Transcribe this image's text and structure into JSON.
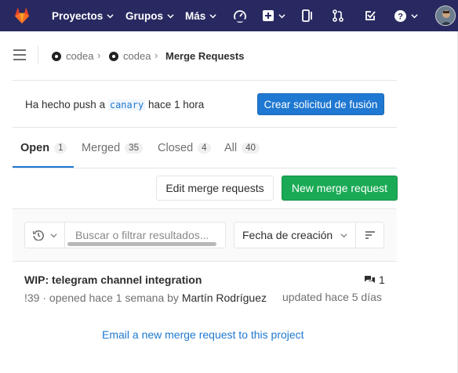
{
  "navbar": {
    "items": [
      {
        "label": "Proyectos"
      },
      {
        "label": "Grupos"
      },
      {
        "label": "Más"
      }
    ],
    "icons": [
      "gitlab-logo",
      "dashboard-gauge-icon",
      "plus-square-icon",
      "issues-icon",
      "merge-request-icon",
      "todo-check-icon",
      "help-icon",
      "user-avatar"
    ]
  },
  "breadcrumb": {
    "items": [
      {
        "label": "codea"
      },
      {
        "label": "codea"
      }
    ],
    "current": "Merge Requests"
  },
  "push_banner": {
    "prefix": "Ha hecho push a",
    "branch": "canary",
    "suffix": "hace 1 hora",
    "button_label": "Crear solicitud de fusión"
  },
  "tabs": [
    {
      "label": "Open",
      "count": "1"
    },
    {
      "label": "Merged",
      "count": "35"
    },
    {
      "label": "Closed",
      "count": "4"
    },
    {
      "label": "All",
      "count": "40"
    }
  ],
  "actions": {
    "edit_label": "Edit merge requests",
    "new_label": "New merge request"
  },
  "filter": {
    "search_placeholder": "Buscar o filtrar resultados...",
    "sort_label": "Fecha de creación"
  },
  "merge_requests": [
    {
      "title": "WIP: telegram channel integration",
      "ref": "!39",
      "opened": "· opened hace 1 semana by",
      "author": "Martín Rodríguez",
      "comments": "1",
      "updated": "updated hace 5 días"
    }
  ],
  "email_link": "Email a new merge request to this project",
  "colors": {
    "navbar": "#292961",
    "primary_blue": "#1f78d1",
    "success_green": "#1aaa55"
  }
}
